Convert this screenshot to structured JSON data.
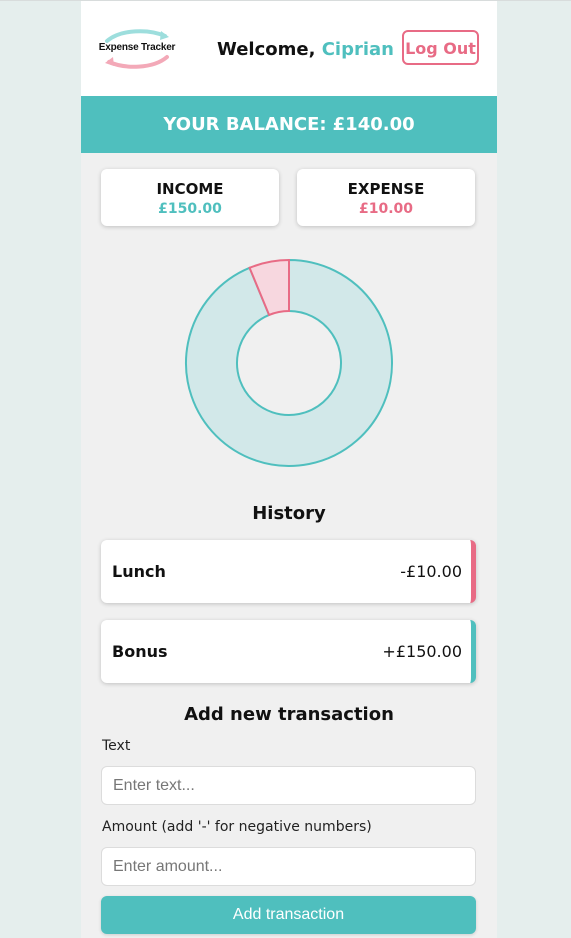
{
  "header": {
    "logo_text": "Expense Tracker",
    "welcome_prefix": "Welcome, ",
    "user_name": "Ciprian",
    "logout_label": "Log Out"
  },
  "balance": {
    "label": "YOUR BALANCE:",
    "amount": "£140.00"
  },
  "summary": {
    "income_label": "INCOME",
    "income_value": "£150.00",
    "expense_label": "EXPENSE",
    "expense_value": "£10.00"
  },
  "chart_data": {
    "type": "pie",
    "style": "doughnut",
    "categories": [
      "Income",
      "Expense"
    ],
    "values": [
      150,
      10
    ],
    "colors": [
      "#4fbfbe",
      "#e86b85"
    ]
  },
  "history": {
    "title": "History",
    "items": [
      {
        "text": "Lunch",
        "amount": "-£10.00",
        "kind": "expense"
      },
      {
        "text": "Bonus",
        "amount": "+£150.00",
        "kind": "income"
      }
    ]
  },
  "form": {
    "title": "Add new transaction",
    "text_label": "Text",
    "text_placeholder": "Enter text...",
    "amount_label": "Amount (add '-' for negative numbers)",
    "amount_placeholder": "Enter amount...",
    "submit_label": "Add transaction"
  },
  "colors": {
    "accent": "#4fbfbe",
    "expense": "#e86b85",
    "page_bg": "#e5eeed",
    "panel_bg": "#f0f0f0"
  }
}
